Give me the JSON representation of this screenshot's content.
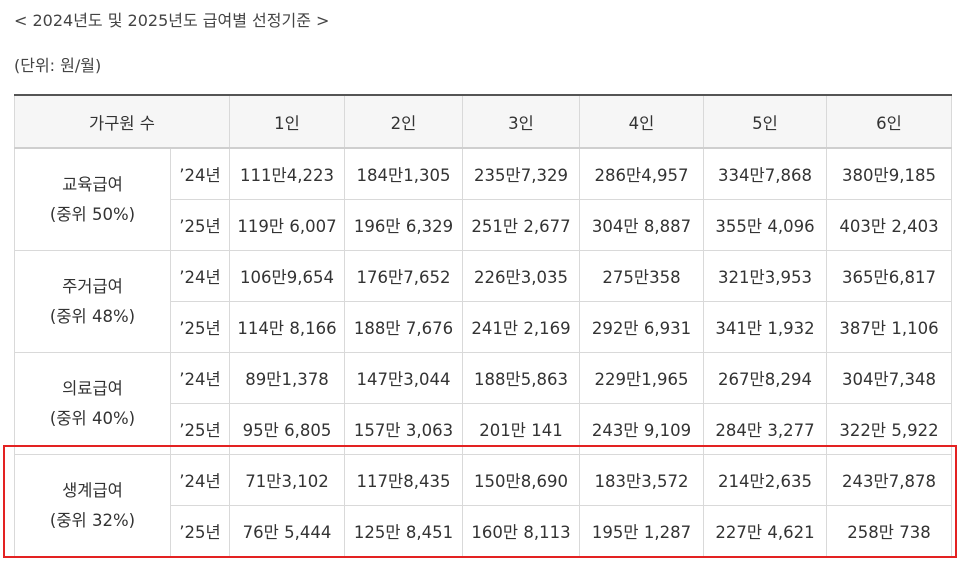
{
  "title": "< 2024년도 및 2025년도 급여별 선정기준 >",
  "unit_note": "(단위: 원/월)",
  "table": {
    "header": {
      "household_label": "가구원 수",
      "columns": [
        "1인",
        "2인",
        "3인",
        "4인",
        "5인",
        "6인"
      ]
    },
    "groups": [
      {
        "name": "교육급여",
        "criterion": "(중위 50%)",
        "highlighted": false,
        "rows": [
          {
            "year": "’24년",
            "values": [
              "111만4,223",
              "184만1,305",
              "235만7,329",
              "286만4,957",
              "334만7,868",
              "380만9,185"
            ]
          },
          {
            "year": "’25년",
            "values": [
              "119만 6,007",
              "196만 6,329",
              "251만 2,677",
              "304만 8,887",
              "355만 4,096",
              "403만 2,403"
            ]
          }
        ]
      },
      {
        "name": "주거급여",
        "criterion": "(중위 48%)",
        "highlighted": false,
        "rows": [
          {
            "year": "’24년",
            "values": [
              "106만9,654",
              "176만7,652",
              "226만3,035",
              "275만358",
              "321만3,953",
              "365만6,817"
            ]
          },
          {
            "year": "’25년",
            "values": [
              "114만 8,166",
              "188만 7,676",
              "241만 2,169",
              "292만 6,931",
              "341만 1,932",
              "387만 1,106"
            ]
          }
        ]
      },
      {
        "name": "의료급여",
        "criterion": "(중위 40%)",
        "highlighted": false,
        "rows": [
          {
            "year": "’24년",
            "values": [
              "89만1,378",
              "147만3,044",
              "188만5,863",
              "229만1,965",
              "267만8,294",
              "304만7,348"
            ]
          },
          {
            "year": "’25년",
            "values": [
              "95만 6,805",
              "157만 3,063",
              "201만 141",
              "243만 9,109",
              "284만 3,277",
              "322만 5,922"
            ]
          }
        ]
      },
      {
        "name": "생계급여",
        "criterion": "(중위 32%)",
        "highlighted": true,
        "rows": [
          {
            "year": "’24년",
            "values": [
              "71만3,102",
              "117만8,435",
              "150만8,690",
              "183만3,572",
              "214만2,635",
              "243만7,878"
            ]
          },
          {
            "year": "’25년",
            "values": [
              "76만 5,444",
              "125만 8,451",
              "160만 8,113",
              "195만 1,287",
              "227만 4,621",
              "258만 738"
            ]
          }
        ]
      }
    ]
  },
  "colors": {
    "highlight_border": "#e32222",
    "header_background": "#f6f6f6",
    "grid_line": "#d9d9d9"
  }
}
